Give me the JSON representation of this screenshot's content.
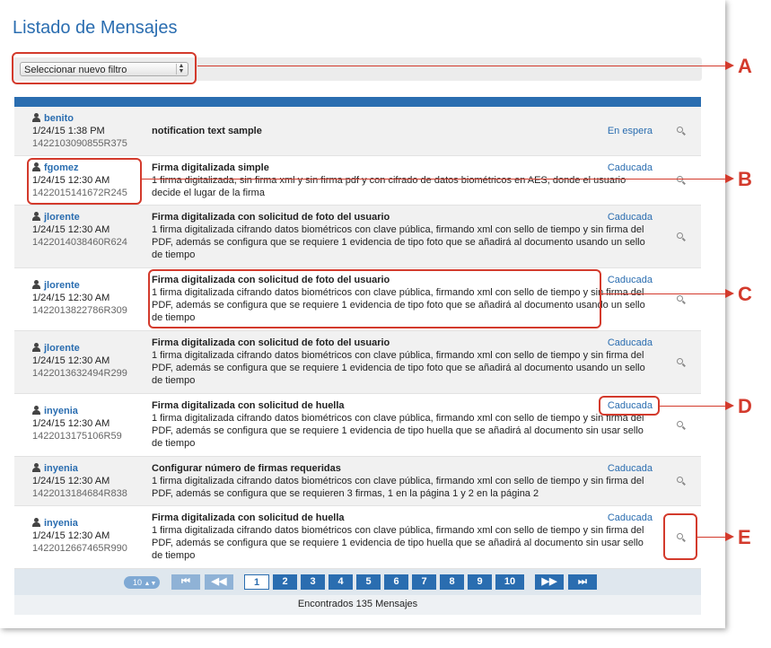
{
  "page": {
    "title": "Listado de Mensajes"
  },
  "filter": {
    "placeholder": "Seleccionar nuevo filtro",
    "arrows": "▲▼"
  },
  "messages": [
    {
      "user": "benito",
      "date": "1/24/15 1:38 PM",
      "code": "1422103090855R375",
      "title": "notification text sample",
      "desc": "",
      "status": "En espera"
    },
    {
      "user": "fgomez",
      "date": "1/24/15 12:30 AM",
      "code": "1422015141672R245",
      "title": "Firma digitalizada simple",
      "desc": "1 firma digitalizada, sin firma xml y sin firma pdf y con cifrado de datos biométricos en AES, donde el usuario decide el lugar de la firma",
      "status": "Caducada"
    },
    {
      "user": "jlorente",
      "date": "1/24/15 12:30 AM",
      "code": "1422014038460R624",
      "title": "Firma digitalizada con solicitud de foto del usuario",
      "desc": "1 firma digitalizada cifrando datos biométricos con clave pública, firmando xml con sello de tiempo y sin firma del PDF, además se configura que se requiere 1 evidencia de tipo foto que se añadirá al documento usando un sello de tiempo",
      "status": "Caducada"
    },
    {
      "user": "jlorente",
      "date": "1/24/15 12:30 AM",
      "code": "1422013822786R309",
      "title": "Firma digitalizada con solicitud de foto del usuario",
      "desc": "1 firma digitalizada cifrando datos biométricos con clave pública, firmando xml con sello de tiempo y sin firma del PDF, además se configura que se requiere 1 evidencia de tipo foto que se añadirá al documento usando un sello de tiempo",
      "status": "Caducada"
    },
    {
      "user": "jlorente",
      "date": "1/24/15 12:30 AM",
      "code": "1422013632494R299",
      "title": "Firma digitalizada con solicitud de foto del usuario",
      "desc": "1 firma digitalizada cifrando datos biométricos con clave pública, firmando xml con sello de tiempo y sin firma del PDF, además se configura que se requiere 1 evidencia de tipo foto que se añadirá al documento usando un sello de tiempo",
      "status": "Caducada"
    },
    {
      "user": "inyenia",
      "date": "1/24/15 12:30 AM",
      "code": "1422013175106R59",
      "title": "Firma digitalizada con solicitud de huella",
      "desc": "1 firma digitalizada cifrando datos biométricos con clave pública, firmando xml con sello de tiempo y sin firma del PDF, además se configura que se requiere 1 evidencia de tipo huella que se añadirá al documento sin usar sello de tiempo",
      "status": "Caducada"
    },
    {
      "user": "inyenia",
      "date": "1/24/15 12:30 AM",
      "code": "1422013184684R838",
      "title": "Configurar número de firmas requeridas",
      "desc": "1 firma digitalizada cifrando datos biométricos con clave pública, firmando xml con sello de tiempo y sin firma del PDF, además se configura que se requieren 3 firmas, 1 en la página 1 y 2 en la página 2",
      "status": "Caducada"
    },
    {
      "user": "inyenia",
      "date": "1/24/15 12:30 AM",
      "code": "1422012667465R990",
      "title": "Firma digitalizada con solicitud de huella",
      "desc": "1 firma digitalizada cifrando datos biométricos con clave pública, firmando xml con sello de tiempo y sin firma del PDF, además se configura que se requiere 1 evidencia de tipo huella que se añadirá al documento sin usar sello de tiempo",
      "status": "Caducada"
    }
  ],
  "pager": {
    "per_page": "10",
    "first": "⏮",
    "prev": "◀◀",
    "pages": [
      "1",
      "2",
      "3",
      "4",
      "5",
      "6",
      "7",
      "8",
      "9",
      "10"
    ],
    "next": "▶▶",
    "last": "⏭"
  },
  "footer": {
    "found": "Encontrados 135 Mensajes"
  },
  "callouts": {
    "a": "A",
    "b": "B",
    "c": "C",
    "d": "D",
    "e": "E"
  },
  "colors": {
    "accent": "#2a6db0",
    "callout": "#d33a2c"
  }
}
